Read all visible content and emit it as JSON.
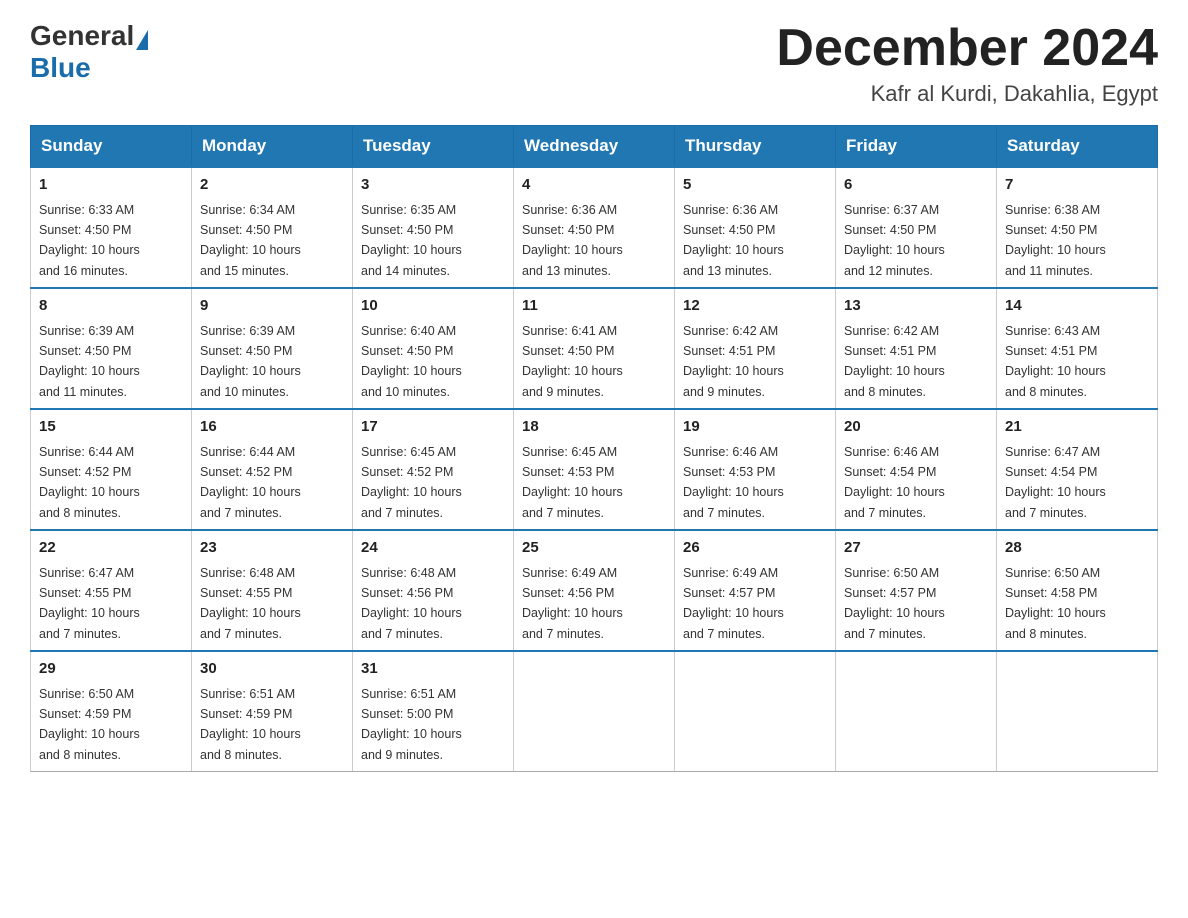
{
  "header": {
    "logo_general": "General",
    "logo_blue": "Blue",
    "main_title": "December 2024",
    "subtitle": "Kafr al Kurdi, Dakahlia, Egypt"
  },
  "days_of_week": [
    "Sunday",
    "Monday",
    "Tuesday",
    "Wednesday",
    "Thursday",
    "Friday",
    "Saturday"
  ],
  "weeks": [
    [
      {
        "day": "1",
        "sunrise": "6:33 AM",
        "sunset": "4:50 PM",
        "daylight": "10 hours and 16 minutes."
      },
      {
        "day": "2",
        "sunrise": "6:34 AM",
        "sunset": "4:50 PM",
        "daylight": "10 hours and 15 minutes."
      },
      {
        "day": "3",
        "sunrise": "6:35 AM",
        "sunset": "4:50 PM",
        "daylight": "10 hours and 14 minutes."
      },
      {
        "day": "4",
        "sunrise": "6:36 AM",
        "sunset": "4:50 PM",
        "daylight": "10 hours and 13 minutes."
      },
      {
        "day": "5",
        "sunrise": "6:36 AM",
        "sunset": "4:50 PM",
        "daylight": "10 hours and 13 minutes."
      },
      {
        "day": "6",
        "sunrise": "6:37 AM",
        "sunset": "4:50 PM",
        "daylight": "10 hours and 12 minutes."
      },
      {
        "day": "7",
        "sunrise": "6:38 AM",
        "sunset": "4:50 PM",
        "daylight": "10 hours and 11 minutes."
      }
    ],
    [
      {
        "day": "8",
        "sunrise": "6:39 AM",
        "sunset": "4:50 PM",
        "daylight": "10 hours and 11 minutes."
      },
      {
        "day": "9",
        "sunrise": "6:39 AM",
        "sunset": "4:50 PM",
        "daylight": "10 hours and 10 minutes."
      },
      {
        "day": "10",
        "sunrise": "6:40 AM",
        "sunset": "4:50 PM",
        "daylight": "10 hours and 10 minutes."
      },
      {
        "day": "11",
        "sunrise": "6:41 AM",
        "sunset": "4:50 PM",
        "daylight": "10 hours and 9 minutes."
      },
      {
        "day": "12",
        "sunrise": "6:42 AM",
        "sunset": "4:51 PM",
        "daylight": "10 hours and 9 minutes."
      },
      {
        "day": "13",
        "sunrise": "6:42 AM",
        "sunset": "4:51 PM",
        "daylight": "10 hours and 8 minutes."
      },
      {
        "day": "14",
        "sunrise": "6:43 AM",
        "sunset": "4:51 PM",
        "daylight": "10 hours and 8 minutes."
      }
    ],
    [
      {
        "day": "15",
        "sunrise": "6:44 AM",
        "sunset": "4:52 PM",
        "daylight": "10 hours and 8 minutes."
      },
      {
        "day": "16",
        "sunrise": "6:44 AM",
        "sunset": "4:52 PM",
        "daylight": "10 hours and 7 minutes."
      },
      {
        "day": "17",
        "sunrise": "6:45 AM",
        "sunset": "4:52 PM",
        "daylight": "10 hours and 7 minutes."
      },
      {
        "day": "18",
        "sunrise": "6:45 AM",
        "sunset": "4:53 PM",
        "daylight": "10 hours and 7 minutes."
      },
      {
        "day": "19",
        "sunrise": "6:46 AM",
        "sunset": "4:53 PM",
        "daylight": "10 hours and 7 minutes."
      },
      {
        "day": "20",
        "sunrise": "6:46 AM",
        "sunset": "4:54 PM",
        "daylight": "10 hours and 7 minutes."
      },
      {
        "day": "21",
        "sunrise": "6:47 AM",
        "sunset": "4:54 PM",
        "daylight": "10 hours and 7 minutes."
      }
    ],
    [
      {
        "day": "22",
        "sunrise": "6:47 AM",
        "sunset": "4:55 PM",
        "daylight": "10 hours and 7 minutes."
      },
      {
        "day": "23",
        "sunrise": "6:48 AM",
        "sunset": "4:55 PM",
        "daylight": "10 hours and 7 minutes."
      },
      {
        "day": "24",
        "sunrise": "6:48 AM",
        "sunset": "4:56 PM",
        "daylight": "10 hours and 7 minutes."
      },
      {
        "day": "25",
        "sunrise": "6:49 AM",
        "sunset": "4:56 PM",
        "daylight": "10 hours and 7 minutes."
      },
      {
        "day": "26",
        "sunrise": "6:49 AM",
        "sunset": "4:57 PM",
        "daylight": "10 hours and 7 minutes."
      },
      {
        "day": "27",
        "sunrise": "6:50 AM",
        "sunset": "4:57 PM",
        "daylight": "10 hours and 7 minutes."
      },
      {
        "day": "28",
        "sunrise": "6:50 AM",
        "sunset": "4:58 PM",
        "daylight": "10 hours and 8 minutes."
      }
    ],
    [
      {
        "day": "29",
        "sunrise": "6:50 AM",
        "sunset": "4:59 PM",
        "daylight": "10 hours and 8 minutes."
      },
      {
        "day": "30",
        "sunrise": "6:51 AM",
        "sunset": "4:59 PM",
        "daylight": "10 hours and 8 minutes."
      },
      {
        "day": "31",
        "sunrise": "6:51 AM",
        "sunset": "5:00 PM",
        "daylight": "10 hours and 9 minutes."
      },
      null,
      null,
      null,
      null
    ]
  ],
  "labels": {
    "sunrise": "Sunrise:",
    "sunset": "Sunset:",
    "daylight": "Daylight:"
  }
}
